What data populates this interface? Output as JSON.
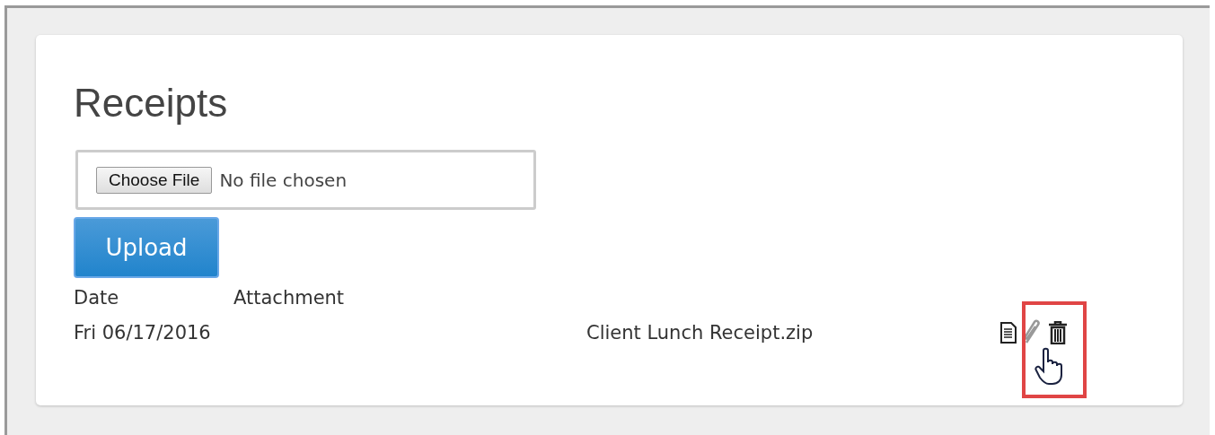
{
  "title": "Receipts",
  "file_input": {
    "button": "Choose File",
    "status": "No file chosen"
  },
  "upload_button": "Upload",
  "table": {
    "columns": [
      "Date",
      "Attachment"
    ],
    "rows": [
      {
        "date": "Fri 06/17/2016",
        "attachment": "Client Lunch Receipt.zip"
      }
    ]
  }
}
